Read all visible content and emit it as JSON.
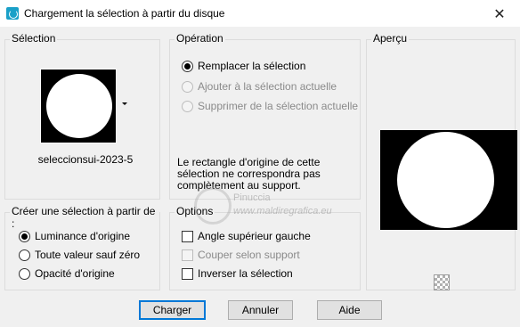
{
  "window": {
    "title": "Chargement la sélection à partir du disque",
    "close_symbol": "✕"
  },
  "selection": {
    "label": "Sélection",
    "thumbnail_name": "seleccionsui-2023-5"
  },
  "operation": {
    "label": "Opération",
    "options": [
      {
        "label": "Remplacer la sélection",
        "checked": true,
        "enabled": true
      },
      {
        "label": "Ajouter à la sélection actuelle",
        "checked": false,
        "enabled": false
      },
      {
        "label": "Supprimer de la sélection actuelle",
        "checked": false,
        "enabled": false
      }
    ],
    "note": "Le rectangle d'origine de cette sélection ne correspondra pas complètement au support."
  },
  "preview": {
    "label": "Aperçu",
    "icon": "checkerboard-icon"
  },
  "create_from": {
    "label": "Créer une sélection à partir de :",
    "options": [
      {
        "label": "Luminance d'origine",
        "checked": true
      },
      {
        "label": "Toute valeur sauf zéro",
        "checked": false
      },
      {
        "label": "Opacité d'origine",
        "checked": false
      }
    ]
  },
  "options": {
    "label": "Options",
    "items": [
      {
        "label": "Angle supérieur gauche",
        "checked": false,
        "enabled": true
      },
      {
        "label": "Couper selon support",
        "checked": false,
        "enabled": false
      },
      {
        "label": "Inverser la sélection",
        "checked": false,
        "enabled": true
      }
    ]
  },
  "buttons": {
    "load": "Charger",
    "cancel": "Annuler",
    "help": "Aide"
  },
  "watermark": {
    "name": "Pinuccia",
    "site": "www.maldiregrafica.eu"
  },
  "colors": {
    "accent": "#0078d7",
    "title_icon": "#1aa0c8"
  }
}
